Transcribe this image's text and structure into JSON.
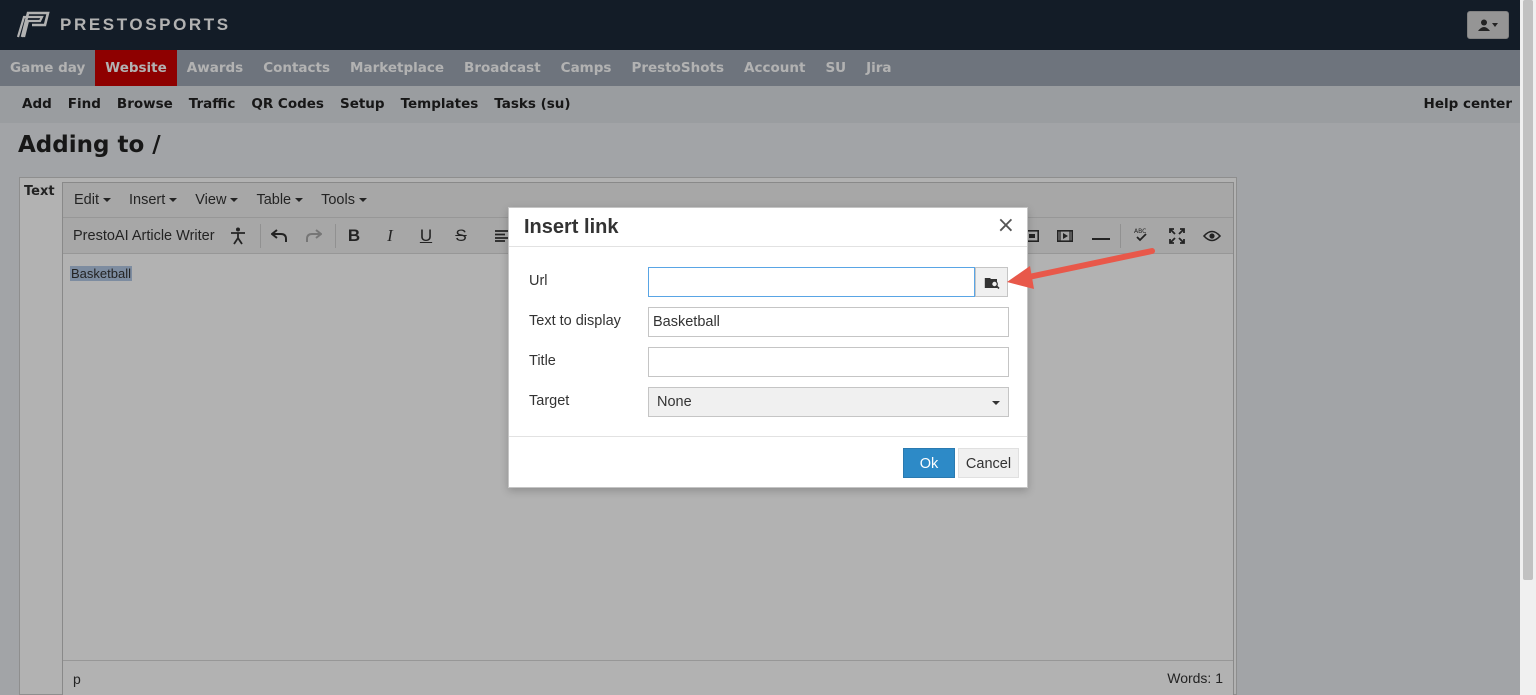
{
  "brand": {
    "name": "PRESTOSPORTS"
  },
  "main_nav": [
    "Game day",
    "Website",
    "Awards",
    "Contacts",
    "Marketplace",
    "Broadcast",
    "Camps",
    "PrestoShots",
    "Account",
    "SU",
    "Jira"
  ],
  "main_nav_active": "Website",
  "sub_nav": [
    "Add",
    "Find",
    "Browse",
    "Traffic",
    "QR Codes",
    "Setup",
    "Templates",
    "Tasks (su)"
  ],
  "help_center": "Help center",
  "page_title": "Adding to /",
  "editor": {
    "field_label": "Text",
    "menus": [
      "Edit",
      "Insert",
      "View",
      "Table",
      "Tools"
    ],
    "writer_button": "PrestoAI Article Writer",
    "content": "Basketball",
    "status_path": "p",
    "word_count": "Words: 1"
  },
  "dialog": {
    "title": "Insert link",
    "url_label": "Url",
    "url_value": "",
    "text_label": "Text to display",
    "text_value": "Basketball",
    "title_label": "Title",
    "title_value": "",
    "target_label": "Target",
    "target_value": "None",
    "ok_label": "Ok",
    "cancel_label": "Cancel"
  },
  "colors": {
    "topbar": "#1c2939",
    "nav_active": "#cc0000",
    "ok_button": "#2d8ac7",
    "annotation_arrow": "#e8584a"
  },
  "icons": [
    "presto-logo-icon",
    "user-icon",
    "accessibility-icon",
    "undo-icon",
    "redo-icon",
    "bold-icon",
    "italic-icon",
    "underline-icon",
    "strikethrough-icon",
    "align-icon",
    "image-icon",
    "media-icon",
    "horizontal-rule-icon",
    "spellcheck-icon",
    "fullscreen-icon",
    "preview-icon",
    "close-icon",
    "browse-folder-icon"
  ]
}
